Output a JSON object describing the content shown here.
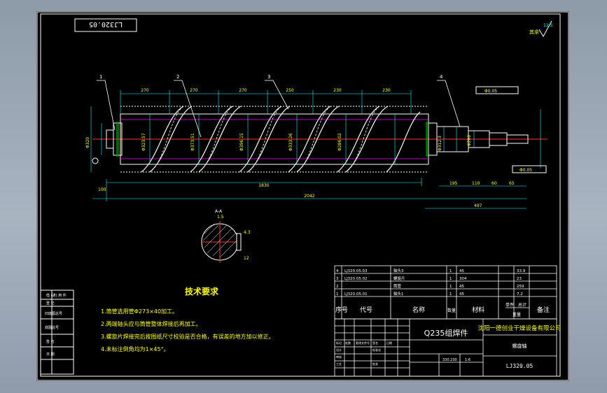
{
  "drawing_no_rotated": "LJ320.05",
  "roughness": {
    "value": "12.5",
    "label": "其余"
  },
  "balloons": [
    "1",
    "2",
    "3",
    "4"
  ],
  "dims_top": [
    "270",
    "270",
    "270",
    "250",
    "230",
    "230"
  ],
  "dims_bottom": {
    "d1": "100",
    "d2": "1830",
    "d3": "2042",
    "d4": "195",
    "d5": "110",
    "d6": "60",
    "d7": "65",
    "d8": "497"
  },
  "dims_mid": [
    "Φ323.57",
    "Φ373.51",
    "Φ396.15",
    "Φ333.26",
    "Φ286.02",
    "Φ312.3",
    "Φ200"
  ],
  "dim_left": "Φ320",
  "dim_tol": "Φ0.05",
  "section": {
    "label": "A-A",
    "t1": "12",
    "t2": "4.3",
    "t3": "1.5"
  },
  "notes": {
    "title": "技术要求",
    "items": [
      "1.筒管选用管Φ273×40加工。",
      "2.两端轴头应与筒管整体焊接后再加工。",
      "3.螺旋片焊接完后按图纸尺寸校验是否合格，有误差的地方加以修正。",
      "4.未标注倒角均为1×45°。"
    ]
  },
  "bom": {
    "rows": [
      {
        "no": "4",
        "code": "LJ320.05.03",
        "name": "轴头3",
        "qty": "1",
        "mat": "45",
        "weight": "33.9"
      },
      {
        "no": "3",
        "code": "LJ320.05.02",
        "name": "螺旋片",
        "qty": "1",
        "mat": "304",
        "weight": "23"
      },
      {
        "no": "2",
        "code": "",
        "name": "筒管",
        "qty": "1",
        "mat": "45",
        "weight": "259"
      },
      {
        "no": "1",
        "code": "LJ320.05.01",
        "name": "轴头1",
        "qty": "1",
        "mat": "45",
        "weight": "7.2"
      }
    ],
    "headers": {
      "no": "序号",
      "code": "代号",
      "name": "名称",
      "qty": "数量",
      "mat": "材料",
      "unit_w": "单件",
      "total_w": "总计",
      "weight_label": "重量",
      "remark": "备注"
    }
  },
  "title_block": {
    "material": "Q235组焊件",
    "company": "沈阳一德创业干燥设备有限公司",
    "part_name": "螺旋轴",
    "drawing_no": "LJ320.05",
    "weight": "330.230",
    "scale": "1:6",
    "small_labels": [
      "标记",
      "处数",
      "更改文件号",
      "签名",
      "日期",
      "设计",
      "标准化",
      "审核",
      "工艺",
      "批准"
    ]
  },
  "left_strip": [
    "借 (通) 用 件",
    "登 记",
    "旧底图总号",
    "底图总号",
    "签 名",
    "日 期"
  ]
}
